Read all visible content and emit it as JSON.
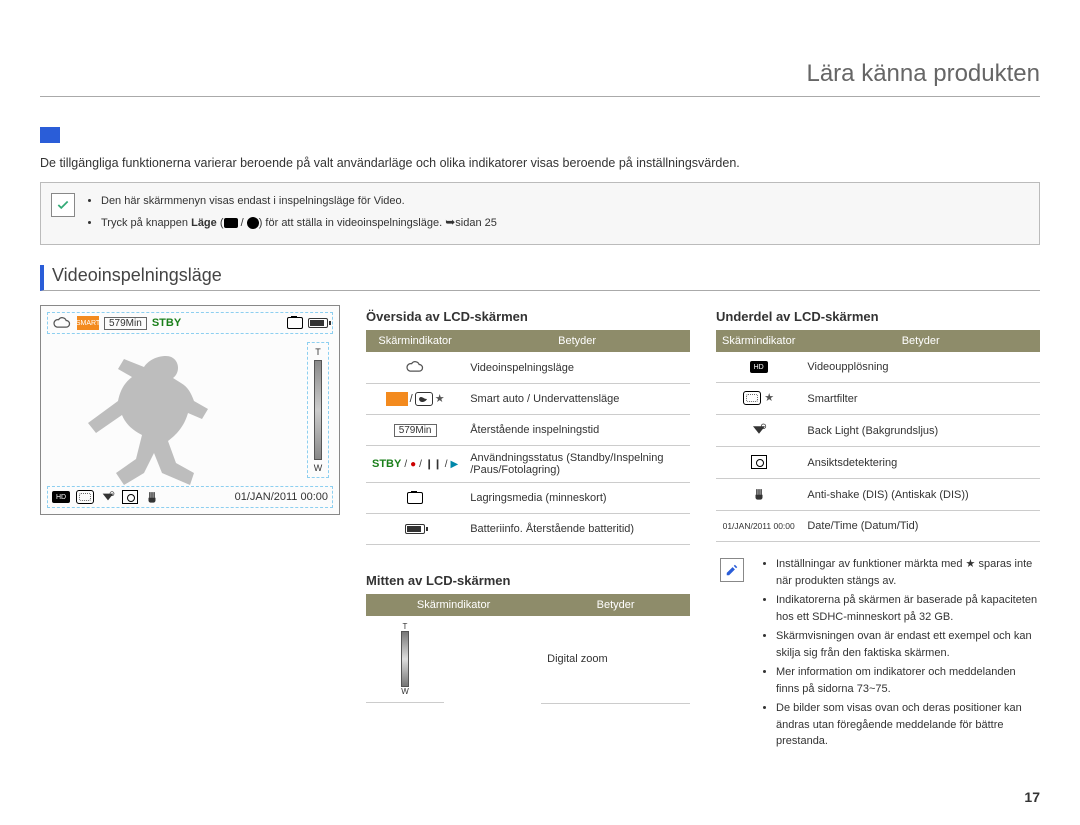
{
  "header": {
    "title": "Lära känna produkten"
  },
  "intro": "De tillgängliga funktionerna varierar beroende på valt användarläge och olika indikatorer visas beroende på inställningsvärden.",
  "note1": {
    "items": [
      "Den här skärmmenyn visas endast i inspelningsläge för Video.",
      "Tryck på knappen"
    ],
    "bold_word": "Läge",
    "tail": "för att ställa in videoinspelningsläge.",
    "page_ref": "sidan 25"
  },
  "section_title": "Videoinspelningsläge",
  "lcd": {
    "time_remaining": "579Min",
    "stby": "STBY",
    "date_time": "01/JAN/2011 00:00",
    "zoom_top": "T",
    "zoom_bottom": "W"
  },
  "tables": {
    "header_left": "Skärmindikator",
    "header_right": "Betyder",
    "top": {
      "title": "Översida av LCD-skärmen",
      "rows": [
        {
          "label": "cloud",
          "text": "Videoinspelningsläge"
        },
        {
          "label": "smart",
          "text": "Smart auto / Undervattensläge"
        },
        {
          "label": "579Min",
          "text": "Återstående inspelningstid"
        },
        {
          "label": "stby",
          "text": "Användningsstatus (Standby/Inspelning /Paus/Fotolagring)"
        },
        {
          "label": "card",
          "text": "Lagringsmedia (minneskort)"
        },
        {
          "label": "batt",
          "text": "Batteriinfo. Återstående batteritid)"
        }
      ]
    },
    "middle": {
      "title": "Mitten av LCD-skärmen",
      "rows": [
        {
          "label": "zoom",
          "text": "Digital zoom"
        }
      ]
    },
    "bottom": {
      "title": "Underdel av LCD-skärmen",
      "rows": [
        {
          "label": "hd",
          "text": "Videoupplösning"
        },
        {
          "label": "sf",
          "text": "Smartfilter"
        },
        {
          "label": "bl",
          "text": "Back Light (Bakgrundsljus)"
        },
        {
          "label": "face",
          "text": "Ansiktsdetektering"
        },
        {
          "label": "hand",
          "text": "Anti-shake (DIS) (Antiskak (DIS))"
        },
        {
          "label": "01/JAN/2011 00:00",
          "text": "Date/Time (Datum/Tid)"
        }
      ]
    }
  },
  "notes2": {
    "items": [
      "Inställningar av funktioner märkta med ★ sparas inte när produkten stängs av.",
      "Indikatorerna på skärmen är baserade på kapaciteten hos ett SDHC-minneskort på 32 GB.",
      "Skärmvisningen ovan är endast ett exempel och kan skilja sig från den faktiska skärmen.",
      "Mer information om indikatorer och meddelanden finns på sidorna 73~75.",
      "De bilder som visas ovan och deras positioner kan ändras utan föregående meddelande för bättre prestanda."
    ]
  },
  "page_number": "17",
  "stby_modes": {
    "a": "STBY",
    "rec": "●",
    "pause": "❙❙",
    "save": "▶"
  }
}
